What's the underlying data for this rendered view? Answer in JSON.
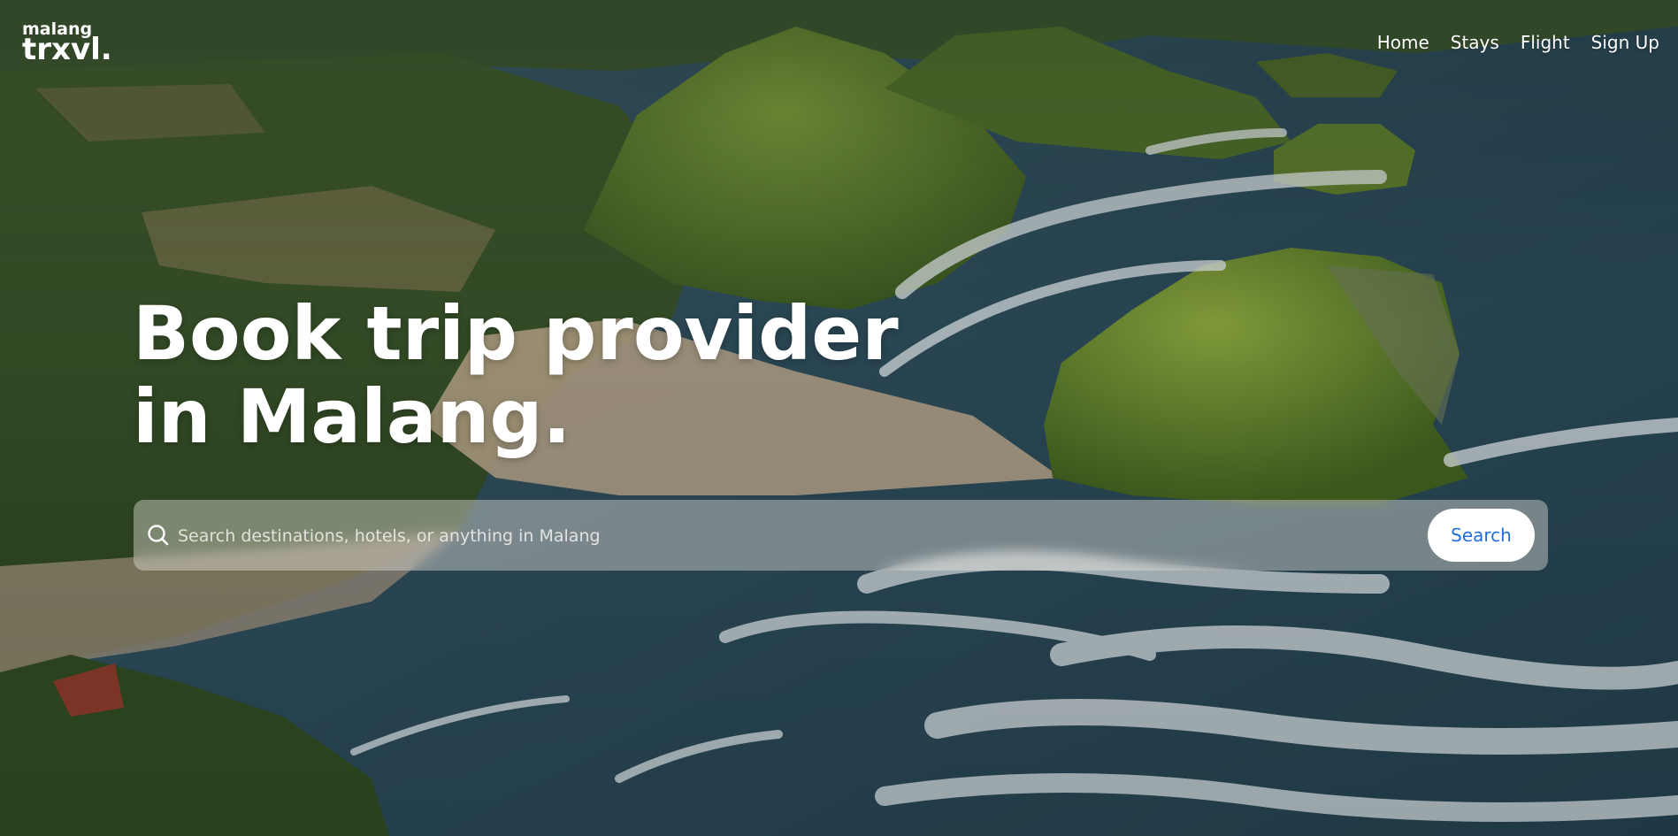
{
  "brand": {
    "line1": "malang",
    "line2": "trxvl."
  },
  "nav": {
    "items": [
      {
        "label": "Home"
      },
      {
        "label": "Stays"
      },
      {
        "label": "Flight"
      },
      {
        "label": "Sign Up"
      }
    ]
  },
  "hero": {
    "headline_line1": "Book trip provider",
    "headline_line2": "in Malang.",
    "background": "aerial-coastline-photo"
  },
  "search": {
    "placeholder": "Search destinations, hotels, or anything in Malang",
    "value": "",
    "button_label": "Search",
    "icon": "search-icon"
  },
  "colors": {
    "accent": "#1f6fe0",
    "button_bg": "#ffffff",
    "text": "#ffffff"
  }
}
